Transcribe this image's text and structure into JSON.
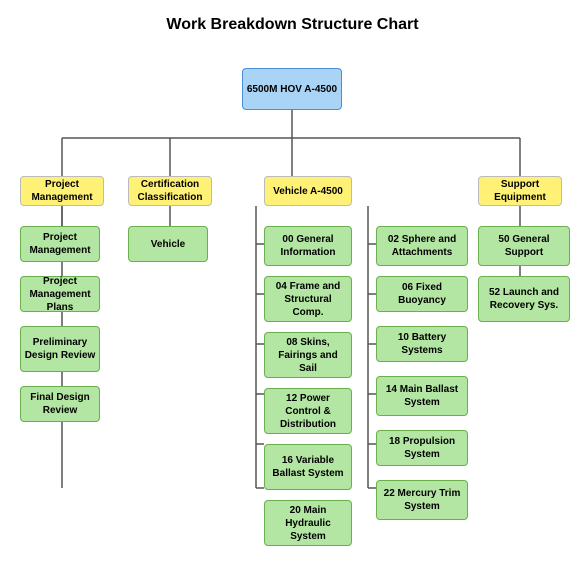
{
  "title": "Work Breakdown Structure Chart",
  "nodes": {
    "root": {
      "label": "6500M HOV\nA-4500",
      "color": "blue"
    },
    "pm": {
      "label": "Project\nManagement",
      "color": "yellow"
    },
    "cc": {
      "label": "Certification\nClassification",
      "color": "yellow"
    },
    "va": {
      "label": "Vehicle\nA-4500",
      "color": "yellow"
    },
    "se": {
      "label": "Support\nEquipment",
      "color": "yellow"
    },
    "pm1": {
      "label": "Project\nManagement",
      "color": "green"
    },
    "pm2": {
      "label": "Project\nManagement\nPlans",
      "color": "green"
    },
    "pm3": {
      "label": "Preliminary\nDesign\nReview",
      "color": "green"
    },
    "pm4": {
      "label": "Final Design\nReview",
      "color": "green"
    },
    "cc1": {
      "label": "Vehicle",
      "color": "green"
    },
    "v1": {
      "label": "00 General\nInformation",
      "color": "green"
    },
    "v2": {
      "label": "04 Frame and\nStructural\nComp.",
      "color": "green"
    },
    "v3": {
      "label": "08 Skins,\nFairings\nand Sail",
      "color": "green"
    },
    "v4": {
      "label": "12 Power\nControl\n& Distribution",
      "color": "green"
    },
    "v5": {
      "label": "16 Variable\nBallast\nSystem",
      "color": "green"
    },
    "v6": {
      "label": "20 Main\nHydraulic\nSystem",
      "color": "green"
    },
    "v7": {
      "label": "02 Sphere and\nAttachments",
      "color": "green"
    },
    "v8": {
      "label": "06 Fixed\nBuoyancy",
      "color": "green"
    },
    "v9": {
      "label": "10 Battery\nSystems",
      "color": "green"
    },
    "v10": {
      "label": "14 Main Ballast\nSystem",
      "color": "green"
    },
    "v11": {
      "label": "18 Propulsion\nSystem",
      "color": "green"
    },
    "v12": {
      "label": "22 Mercury Trim\nSystem",
      "color": "green"
    },
    "se1": {
      "label": "50 General\nSupport",
      "color": "green"
    },
    "se2": {
      "label": "52 Launch and\nRecovery Sys.",
      "color": "green"
    }
  }
}
